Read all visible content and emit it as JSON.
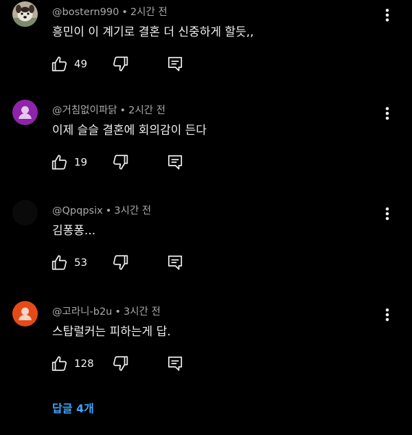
{
  "comments": [
    {
      "author": "@bostern990",
      "time": "2시간 전",
      "text": "흥민이 이 계기로 결혼 더 신중하게 할듯,,",
      "likes": "49",
      "avatar": {
        "type": "dog-photo",
        "color": "#9a8f80"
      }
    },
    {
      "author": "@거침없이파닭",
      "time": "2시간 전",
      "text": "이제 슬슬 결혼에 회의감이 든다",
      "likes": "19",
      "avatar": {
        "type": "default-person",
        "color": "#8e24aa"
      }
    },
    {
      "author": "@Qpqpsix",
      "time": "3시간 전",
      "text": "김퐁퐁...",
      "likes": "53",
      "avatar": {
        "type": "solid",
        "color": "#0a0a0a"
      }
    },
    {
      "author": "@고라니-b2u",
      "time": "3시간 전",
      "text": "스탑럴커는 피하는게 답.",
      "likes": "128",
      "avatar": {
        "type": "default-person",
        "color": "#e64a19"
      }
    }
  ],
  "replies_label": "답글 4개",
  "icons": {
    "like": "thumbs-up-icon",
    "dislike": "thumbs-down-icon",
    "reply": "comment-reply-icon",
    "more": "more-vertical-icon"
  },
  "colors": {
    "background": "#000000",
    "text_primary": "#f1f1f1",
    "text_secondary": "#aaaaaa",
    "link": "#3ea6ff"
  }
}
